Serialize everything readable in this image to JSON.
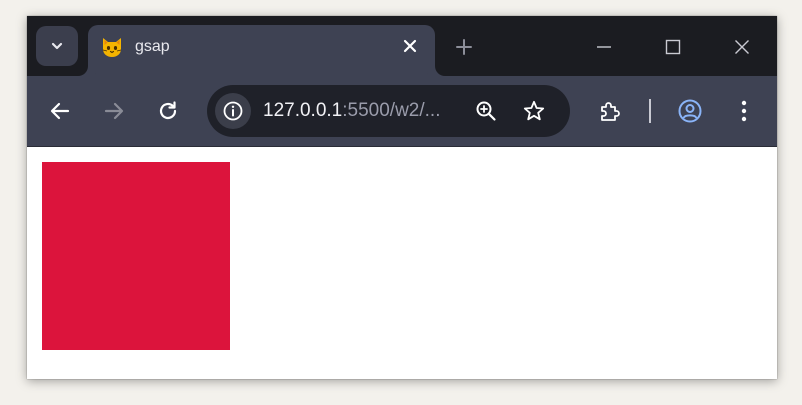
{
  "tab": {
    "title": "gsap",
    "favicon": "cat-face-icon"
  },
  "omnibox": {
    "url_host": "127.0.0.1",
    "url_rest": ":5500/w2/..."
  },
  "page": {
    "box_color": "#dc143c"
  },
  "colors": {
    "tabstrip": "#1b1c21",
    "toolbar": "#3e4253",
    "omnibox": "#1f2129"
  },
  "icons": [
    "chevron-down-icon",
    "cat-face-icon",
    "close-icon",
    "plus-icon",
    "minimize-icon",
    "maximize-icon",
    "window-close-icon",
    "back-arrow-icon",
    "forward-arrow-icon",
    "reload-icon",
    "info-icon",
    "zoom-in-icon",
    "star-icon",
    "puzzle-icon",
    "profile-icon",
    "more-vert-icon"
  ]
}
